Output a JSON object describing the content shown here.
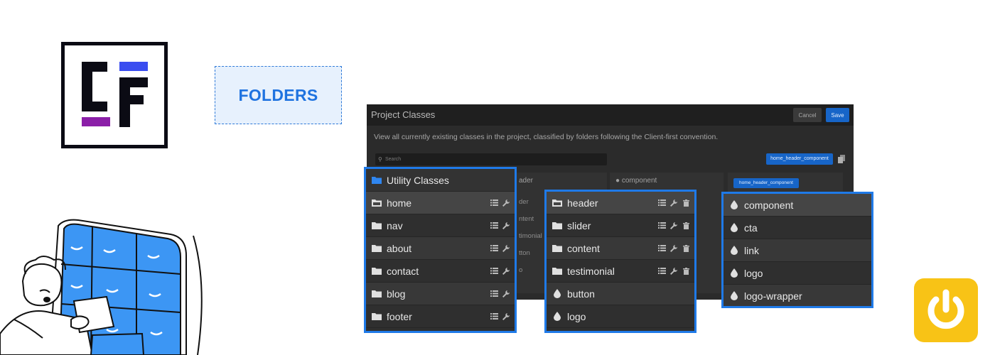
{
  "badge": {
    "label": "FOLDERS"
  },
  "window": {
    "title": "Project Classes",
    "cancel_label": "Cancel",
    "save_label": "Save",
    "description": "View all currently existing classes in the project, classified by folders following the Client-first convention.",
    "search_placeholder": "Search",
    "selected_chip": "home_header_component",
    "column_chip": "home_header_component",
    "bg_columns": [
      {
        "head": "ader",
        "lines": [
          "der",
          "ntent",
          "timonial",
          "tton",
          "o"
        ]
      },
      {
        "head": "component",
        "lines": []
      }
    ]
  },
  "panels": {
    "utility": {
      "header": "Utility Classes",
      "items": [
        "home",
        "nav",
        "about",
        "contact",
        "blog",
        "footer"
      ]
    },
    "home": {
      "folders": [
        "header",
        "slider",
        "content",
        "testimonial"
      ],
      "classes": [
        "button",
        "logo"
      ]
    },
    "header": {
      "classes": [
        "component",
        "cta",
        "link",
        "logo",
        "logo-wrapper"
      ]
    }
  },
  "colors": {
    "accent": "#1f7ae8",
    "logo_blue": "#3a4df0",
    "logo_purple": "#8b1fa8",
    "power_yellow": "#f8c316"
  },
  "icons": {
    "folder": "folder-icon",
    "folder_open": "folder-open-icon",
    "drop": "drop-icon",
    "list": "list-icon",
    "wrench": "wrench-icon",
    "trash": "trash-icon",
    "power": "power-icon"
  }
}
